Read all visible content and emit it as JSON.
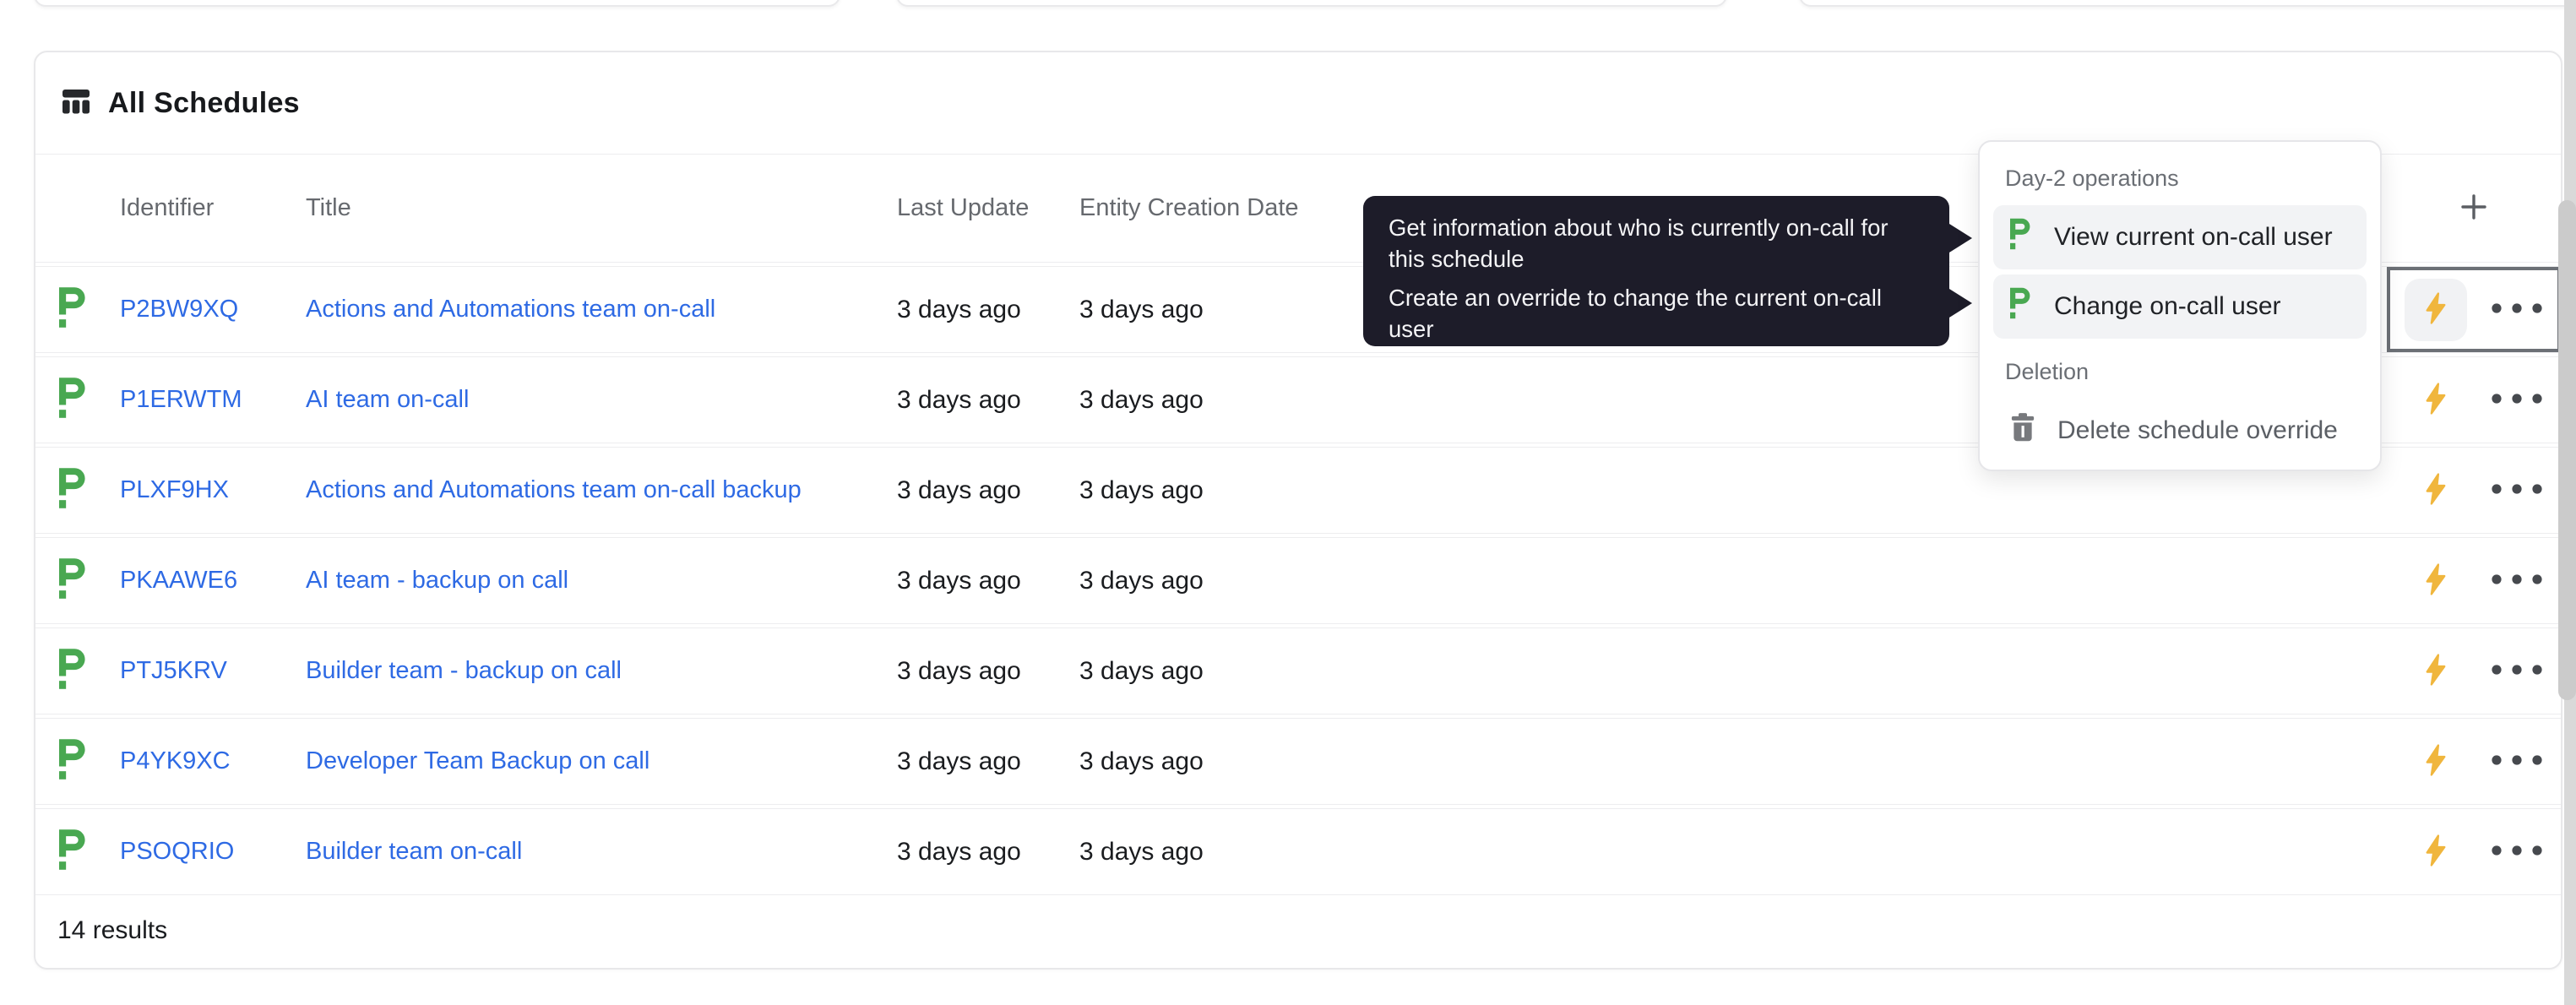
{
  "card": {
    "title": "All Schedules",
    "results_count": "14 results"
  },
  "table": {
    "columns": [
      "Identifier",
      "Title",
      "Last Update",
      "Entity Creation Date"
    ],
    "rows": [
      {
        "identifier": "P2BW9XQ",
        "title": "Actions and Automations team on-call",
        "last_update": "3 days ago",
        "entity_creation_date": "3 days ago"
      },
      {
        "identifier": "P1ERWTM",
        "title": "AI team on-call",
        "last_update": "3 days ago",
        "entity_creation_date": "3 days ago"
      },
      {
        "identifier": "PLXF9HX",
        "title": "Actions and Automations team on-call backup",
        "last_update": "3 days ago",
        "entity_creation_date": "3 days ago"
      },
      {
        "identifier": "PKAAWE6",
        "title": "AI team - backup on call",
        "last_update": "3 days ago",
        "entity_creation_date": "3 days ago"
      },
      {
        "identifier": "PTJ5KRV",
        "title": "Builder team - backup on call",
        "last_update": "3 days ago",
        "entity_creation_date": "3 days ago"
      },
      {
        "identifier": "P4YK9XC",
        "title": "Developer Team Backup on call",
        "last_update": "3 days ago",
        "entity_creation_date": "3 days ago"
      },
      {
        "identifier": "PSOQRIO",
        "title": "Builder team on-call",
        "last_update": "3 days ago",
        "entity_creation_date": "3 days ago"
      }
    ]
  },
  "tooltip": {
    "lines": [
      "Get information about who is currently on-call for this schedule",
      "Create an override to change the current on-call user"
    ]
  },
  "context_menu": {
    "sections": [
      {
        "label": "Day-2 operations",
        "items": [
          {
            "label": "View current on-call user",
            "icon": "pagerduty-icon"
          },
          {
            "label": "Change on-call user",
            "icon": "pagerduty-icon"
          }
        ]
      },
      {
        "label": "Deletion",
        "items": [
          {
            "label": "Delete schedule override",
            "icon": "trash-icon"
          }
        ]
      }
    ]
  },
  "icons": {
    "header": "table-columns-icon",
    "add": "plus-icon",
    "row_entity": "pagerduty-icon",
    "quick_action": "lightning-icon",
    "more": "ellipsis-icon",
    "delete": "trash-icon"
  },
  "colors": {
    "link_blue": "#2e6ae4",
    "pagerduty_green": "#49a851",
    "bolt_yellow": "#f0b63d",
    "tooltip_bg": "#1d1c29",
    "menu_highlight": "#f2f3f5",
    "focus_border": "#6c7076"
  }
}
